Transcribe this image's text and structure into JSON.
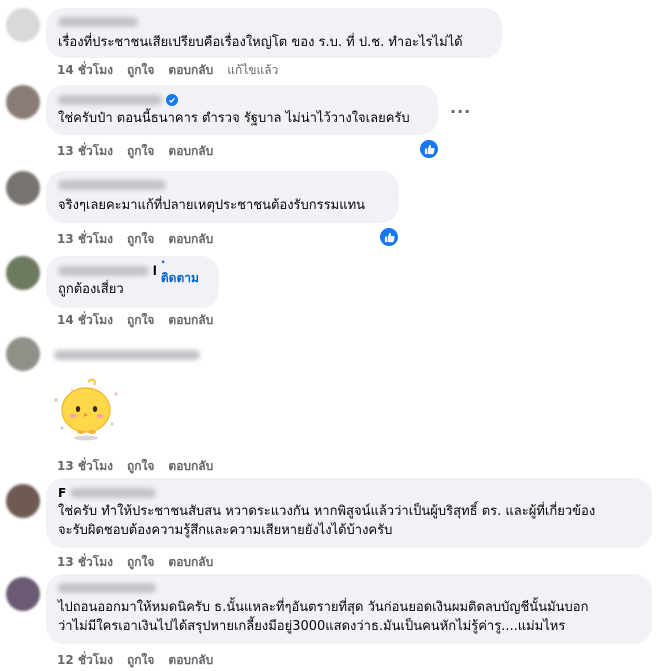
{
  "comments": [
    {
      "text": "เรื่องที่ประชาชนเสียเปรียบคือเรื่องใหญ่โต ของ ร.บ. ที่ ป.ช. ทำอะไรไม่ได้",
      "time": "14 ชั่วโมง",
      "like": "ถูกใจ",
      "reply": "ตอบกลับ",
      "edited": "แก้ไขแล้ว"
    },
    {
      "text": "ใช่ครับป๋า ตอนนี้ธนาคาร ตำรวจ รัฐบาล ไม่น่าไว้วางใจเลยครับ",
      "time": "13 ชั่วโมง",
      "like": "ถูกใจ",
      "reply": "ตอบกลับ"
    },
    {
      "text": "จริงๆเลยคะมาแก้ที่ปลายเหตุประชาชนต้องรับกรรมแทน",
      "time": "13 ชั่วโมง",
      "like": "ถูกใจ",
      "reply": "ตอบกลับ"
    },
    {
      "name_suffix": "l",
      "follow": "· ติดตาม",
      "text": "ถูกต้องเสี่ยว",
      "time": "14 ชั่วโมง",
      "like": "ถูกใจ",
      "reply": "ตอบกลับ"
    },
    {
      "sticker": "yellow-chick-sticker",
      "time": "13 ชั่วโมง",
      "like": "ถูกใจ",
      "reply": "ตอบกลับ"
    },
    {
      "name_initial": "F",
      "line1": "ใช่ครับ ทำให้ประชาชนสับสน หวาดระแวงกัน หากพิสูจน์แล้วว่าเป็นผู้บริสุทธิ์ ตร. และผู้ที่เกี่ยวข้อง",
      "line2": "จะรับผิดชอบต้องความรู้สึกและความเสียหายยังไงได้บ้างครับ",
      "time": "13 ชั่วโมง",
      "like": "ถูกใจ",
      "reply": "ตอบกลับ"
    },
    {
      "line1": "ไปถอนออกมาให้หมดนิครับ ธ.นั้นแหละที่ๆอันตรายที่สุด วันก่อนยอดเงินผมติดลบบัญชีนั้นมันบอก",
      "line2": "ว่าไม่มีใครเอาเงินไปได้สรุปหายเกลี้ยงมีอยู่3000แสดงว่าธ.มันเป็นคนหักไม่รู้ค่ารู....แม่มไหร",
      "time": "12 ชั่วโมง",
      "like": "ถูกใจ",
      "reply": "ตอบกลับ"
    }
  ],
  "more_options": "...",
  "colors": {
    "accent": "#1877f2",
    "bubble": "#f0f2f5",
    "meta": "#65676b"
  },
  "icons": {
    "like": "thumbs-up-icon",
    "verified": "verified-check-icon"
  }
}
